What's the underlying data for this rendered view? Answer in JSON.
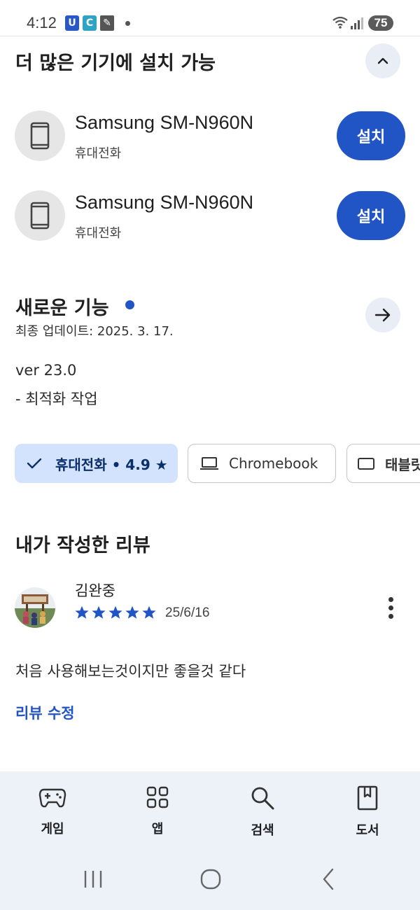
{
  "status_bar": {
    "time": "4:12",
    "battery": "75"
  },
  "install_section": {
    "title": "더 많은 기기에 설치 가능",
    "devices": [
      {
        "name": "Samsung SM-N960N",
        "type": "휴대전화",
        "button": "설치"
      },
      {
        "name": "Samsung SM-N960N",
        "type": "휴대전화",
        "button": "설치"
      }
    ]
  },
  "whats_new": {
    "title": "새로운 기능",
    "updated": "최종 업데이트: 2025. 3. 17.",
    "version": "ver 23.0",
    "note": "- 최적화 작업"
  },
  "chips": [
    {
      "label": "휴대전화 • 4.9 ★",
      "selected": true,
      "icon": "check-icon"
    },
    {
      "label": "Chromebook",
      "selected": false,
      "icon": "laptop-icon"
    },
    {
      "label": "태블릿",
      "selected": false,
      "icon": "tablet-icon"
    }
  ],
  "my_review": {
    "title": "내가 작성한 리뷰",
    "reviewer": "김완중",
    "rating": 5,
    "date": "25/6/16",
    "text": "처음 사용해보는것이지만 좋을것 같다",
    "edit_label": "리뷰 수정"
  },
  "bottom_nav": {
    "items": [
      {
        "label": "게임",
        "icon": "gamepad-icon"
      },
      {
        "label": "앱",
        "icon": "apps-grid-icon"
      },
      {
        "label": "검색",
        "icon": "search-icon"
      },
      {
        "label": "도서",
        "icon": "book-icon"
      }
    ]
  },
  "colors": {
    "accent": "#2155c6",
    "chip_selected_bg": "#d3e3fd",
    "nav_bg": "#edf2f9"
  }
}
